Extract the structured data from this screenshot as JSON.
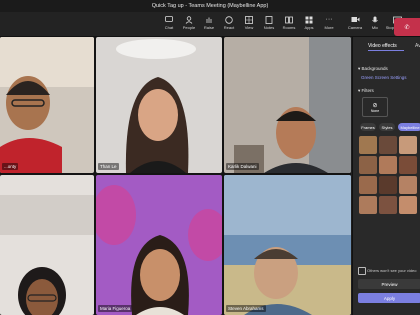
{
  "window": {
    "title": "Quick Tag up - Teams Meeting (Maybelline App)"
  },
  "toolbar": [
    {
      "id": "chat",
      "label": "Chat",
      "icon": "chat-icon"
    },
    {
      "id": "people",
      "label": "People",
      "icon": "people-icon"
    },
    {
      "id": "raise",
      "label": "Raise",
      "icon": "raise-hand-icon"
    },
    {
      "id": "react",
      "label": "React",
      "icon": "react-icon"
    },
    {
      "id": "view",
      "label": "View",
      "icon": "view-icon"
    },
    {
      "id": "notes",
      "label": "Notes",
      "icon": "notes-icon"
    },
    {
      "id": "rooms",
      "label": "Rooms",
      "icon": "rooms-icon"
    },
    {
      "id": "apps",
      "label": "Apps",
      "icon": "apps-icon"
    },
    {
      "id": "more",
      "label": "More",
      "icon": "more-icon"
    },
    {
      "id": "camera",
      "label": "Camera",
      "icon": "camera-icon"
    },
    {
      "id": "mic",
      "label": "Mic",
      "icon": "mic-icon"
    },
    {
      "id": "share",
      "label": "Stop sharing",
      "icon": "share-icon"
    }
  ],
  "participants": [
    {
      "name": "...onty",
      "bg": "#cfc7bd"
    },
    {
      "name": "Than Le",
      "bg": "#d9d6d3"
    },
    {
      "name": "Karlik Dalwani",
      "bg": "#b6aea5"
    },
    {
      "name": "",
      "bg": "#e4e0dc"
    },
    {
      "name": "Maria Figueroa",
      "bg": "#a35bc4"
    },
    {
      "name": "Steven Abrahams",
      "bg": "#6d8fb3"
    }
  ],
  "panel": {
    "tab_active": "Video effects",
    "tab_other": "Av",
    "backgrounds_label": "Backgrounds",
    "backgrounds_value": "Green Screen Settings",
    "filters_label": "Filters",
    "none_label": "None",
    "filter_tabs": [
      "Frames",
      "Styles",
      "Maybelline"
    ],
    "notice": "Others won't see your video",
    "preview": "Preview",
    "apply": "Apply"
  },
  "colors": {
    "accent": "#7b7fe0",
    "leave": "#c4314b",
    "link": "#9aa0ff"
  }
}
